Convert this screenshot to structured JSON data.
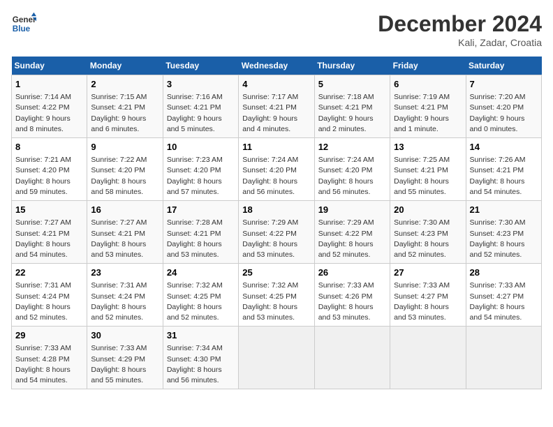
{
  "header": {
    "logo_line1": "General",
    "logo_line2": "Blue",
    "month": "December 2024",
    "location": "Kali, Zadar, Croatia"
  },
  "columns": [
    "Sunday",
    "Monday",
    "Tuesday",
    "Wednesday",
    "Thursday",
    "Friday",
    "Saturday"
  ],
  "weeks": [
    [
      {
        "day": "1",
        "lines": [
          "Sunrise: 7:14 AM",
          "Sunset: 4:22 PM",
          "Daylight: 9 hours",
          "and 8 minutes."
        ]
      },
      {
        "day": "2",
        "lines": [
          "Sunrise: 7:15 AM",
          "Sunset: 4:21 PM",
          "Daylight: 9 hours",
          "and 6 minutes."
        ]
      },
      {
        "day": "3",
        "lines": [
          "Sunrise: 7:16 AM",
          "Sunset: 4:21 PM",
          "Daylight: 9 hours",
          "and 5 minutes."
        ]
      },
      {
        "day": "4",
        "lines": [
          "Sunrise: 7:17 AM",
          "Sunset: 4:21 PM",
          "Daylight: 9 hours",
          "and 4 minutes."
        ]
      },
      {
        "day": "5",
        "lines": [
          "Sunrise: 7:18 AM",
          "Sunset: 4:21 PM",
          "Daylight: 9 hours",
          "and 2 minutes."
        ]
      },
      {
        "day": "6",
        "lines": [
          "Sunrise: 7:19 AM",
          "Sunset: 4:21 PM",
          "Daylight: 9 hours",
          "and 1 minute."
        ]
      },
      {
        "day": "7",
        "lines": [
          "Sunrise: 7:20 AM",
          "Sunset: 4:20 PM",
          "Daylight: 9 hours",
          "and 0 minutes."
        ]
      }
    ],
    [
      {
        "day": "8",
        "lines": [
          "Sunrise: 7:21 AM",
          "Sunset: 4:20 PM",
          "Daylight: 8 hours",
          "and 59 minutes."
        ]
      },
      {
        "day": "9",
        "lines": [
          "Sunrise: 7:22 AM",
          "Sunset: 4:20 PM",
          "Daylight: 8 hours",
          "and 58 minutes."
        ]
      },
      {
        "day": "10",
        "lines": [
          "Sunrise: 7:23 AM",
          "Sunset: 4:20 PM",
          "Daylight: 8 hours",
          "and 57 minutes."
        ]
      },
      {
        "day": "11",
        "lines": [
          "Sunrise: 7:24 AM",
          "Sunset: 4:20 PM",
          "Daylight: 8 hours",
          "and 56 minutes."
        ]
      },
      {
        "day": "12",
        "lines": [
          "Sunrise: 7:24 AM",
          "Sunset: 4:20 PM",
          "Daylight: 8 hours",
          "and 56 minutes."
        ]
      },
      {
        "day": "13",
        "lines": [
          "Sunrise: 7:25 AM",
          "Sunset: 4:21 PM",
          "Daylight: 8 hours",
          "and 55 minutes."
        ]
      },
      {
        "day": "14",
        "lines": [
          "Sunrise: 7:26 AM",
          "Sunset: 4:21 PM",
          "Daylight: 8 hours",
          "and 54 minutes."
        ]
      }
    ],
    [
      {
        "day": "15",
        "lines": [
          "Sunrise: 7:27 AM",
          "Sunset: 4:21 PM",
          "Daylight: 8 hours",
          "and 54 minutes."
        ]
      },
      {
        "day": "16",
        "lines": [
          "Sunrise: 7:27 AM",
          "Sunset: 4:21 PM",
          "Daylight: 8 hours",
          "and 53 minutes."
        ]
      },
      {
        "day": "17",
        "lines": [
          "Sunrise: 7:28 AM",
          "Sunset: 4:21 PM",
          "Daylight: 8 hours",
          "and 53 minutes."
        ]
      },
      {
        "day": "18",
        "lines": [
          "Sunrise: 7:29 AM",
          "Sunset: 4:22 PM",
          "Daylight: 8 hours",
          "and 53 minutes."
        ]
      },
      {
        "day": "19",
        "lines": [
          "Sunrise: 7:29 AM",
          "Sunset: 4:22 PM",
          "Daylight: 8 hours",
          "and 52 minutes."
        ]
      },
      {
        "day": "20",
        "lines": [
          "Sunrise: 7:30 AM",
          "Sunset: 4:23 PM",
          "Daylight: 8 hours",
          "and 52 minutes."
        ]
      },
      {
        "day": "21",
        "lines": [
          "Sunrise: 7:30 AM",
          "Sunset: 4:23 PM",
          "Daylight: 8 hours",
          "and 52 minutes."
        ]
      }
    ],
    [
      {
        "day": "22",
        "lines": [
          "Sunrise: 7:31 AM",
          "Sunset: 4:24 PM",
          "Daylight: 8 hours",
          "and 52 minutes."
        ]
      },
      {
        "day": "23",
        "lines": [
          "Sunrise: 7:31 AM",
          "Sunset: 4:24 PM",
          "Daylight: 8 hours",
          "and 52 minutes."
        ]
      },
      {
        "day": "24",
        "lines": [
          "Sunrise: 7:32 AM",
          "Sunset: 4:25 PM",
          "Daylight: 8 hours",
          "and 52 minutes."
        ]
      },
      {
        "day": "25",
        "lines": [
          "Sunrise: 7:32 AM",
          "Sunset: 4:25 PM",
          "Daylight: 8 hours",
          "and 53 minutes."
        ]
      },
      {
        "day": "26",
        "lines": [
          "Sunrise: 7:33 AM",
          "Sunset: 4:26 PM",
          "Daylight: 8 hours",
          "and 53 minutes."
        ]
      },
      {
        "day": "27",
        "lines": [
          "Sunrise: 7:33 AM",
          "Sunset: 4:27 PM",
          "Daylight: 8 hours",
          "and 53 minutes."
        ]
      },
      {
        "day": "28",
        "lines": [
          "Sunrise: 7:33 AM",
          "Sunset: 4:27 PM",
          "Daylight: 8 hours",
          "and 54 minutes."
        ]
      }
    ],
    [
      {
        "day": "29",
        "lines": [
          "Sunrise: 7:33 AM",
          "Sunset: 4:28 PM",
          "Daylight: 8 hours",
          "and 54 minutes."
        ]
      },
      {
        "day": "30",
        "lines": [
          "Sunrise: 7:33 AM",
          "Sunset: 4:29 PM",
          "Daylight: 8 hours",
          "and 55 minutes."
        ]
      },
      {
        "day": "31",
        "lines": [
          "Sunrise: 7:34 AM",
          "Sunset: 4:30 PM",
          "Daylight: 8 hours",
          "and 56 minutes."
        ]
      },
      null,
      null,
      null,
      null
    ]
  ]
}
